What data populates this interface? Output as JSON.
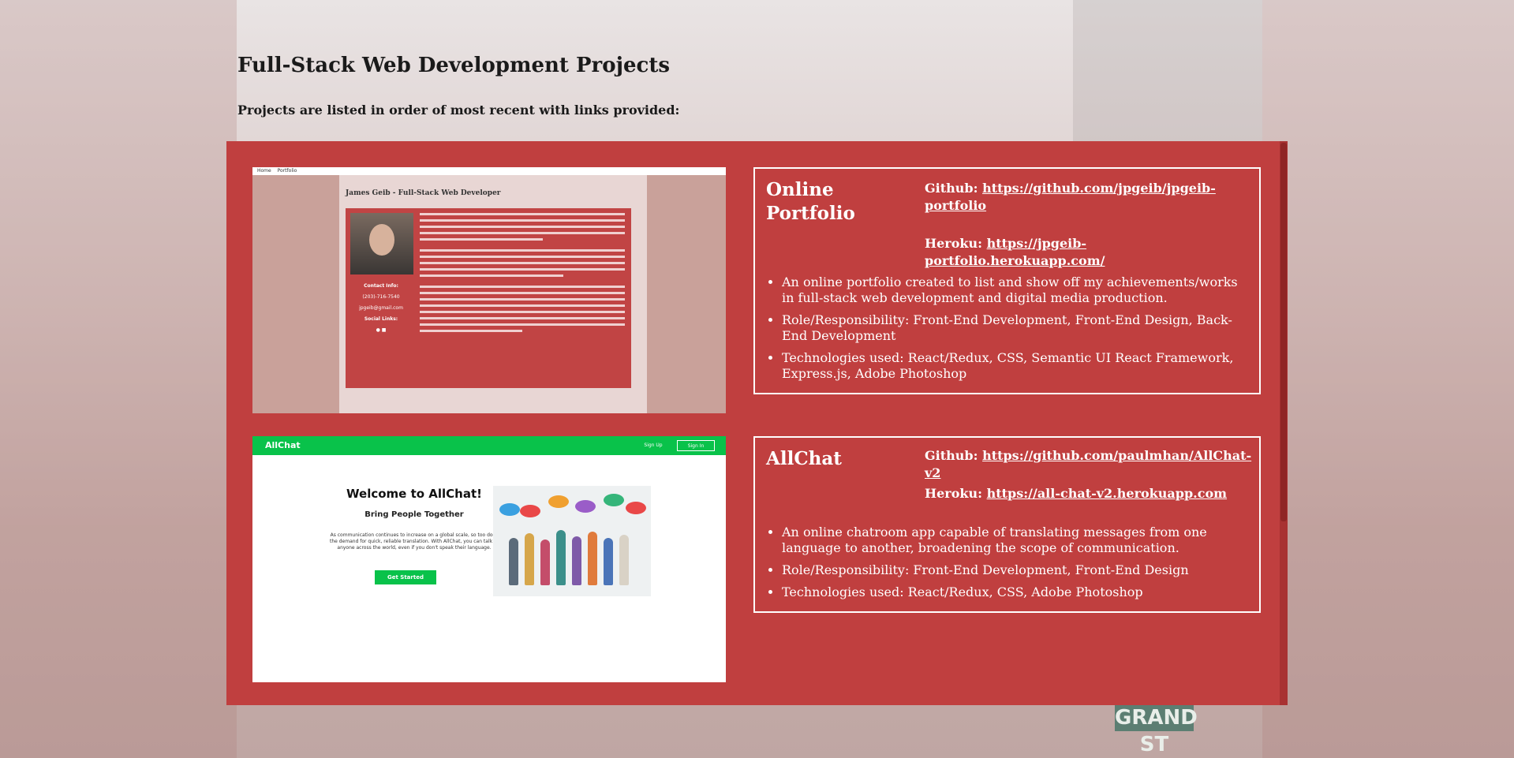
{
  "page": {
    "title": "Full-Stack Web Development Projects",
    "subtitle": "Projects are listed in order of most recent with links provided:"
  },
  "colors": {
    "panel_bg": "#c03f3f",
    "accent_green": "#09c24a",
    "text_white": "#ffffff"
  },
  "projects": [
    {
      "title": "Online Portfolio",
      "github_label": "Github:",
      "github_url": "https://github.com/jpgeib/jpgeib-portfolio",
      "heroku_label": "Heroku:",
      "heroku_url": "https://jpgeib-portfolio.herokuapp.com/",
      "bullets": [
        "An online portfolio created to list and show off my achievements/works in full-stack web development and digital media production.",
        "Role/Responsibility: Front-End Development, Front-End Design, Back-End Development",
        "Technologies used: React/Redux, CSS, Semantic UI React Framework, Express.js, Adobe Photoshop"
      ],
      "preview": {
        "nav": [
          "Home",
          "Portfolio"
        ],
        "heading": "James Geib - Full-Stack Web Developer",
        "contact_label": "Contact Info:",
        "phone": "(203)-716-7540",
        "email": "jpgeib@gmail.com",
        "social_label": "Social Links:"
      }
    },
    {
      "title": "AllChat",
      "github_label": "Github:",
      "github_url": "https://github.com/paulmhan/AllChat-v2",
      "heroku_label": "Heroku:",
      "heroku_url": "https://all-chat-v2.herokuapp.com",
      "bullets": [
        "An online chatroom app capable of translating messages from one language to another, broadening the scope of communication.",
        "Role/Responsibility: Front-End Development, Front-End Design",
        "Technologies used: React/Redux, CSS, Adobe Photoshop"
      ],
      "preview": {
        "logo": "AllChat",
        "signup": "Sign Up",
        "signin": "Sign In",
        "welcome": "Welcome to AllChat!",
        "tagline": "Bring People Together",
        "description": "As communication continues to increase on a global scale, so too does the demand for quick, reliable translation. With AllChat, you can talk to anyone across the world, even if you don't speak their language.",
        "cta": "Get Started"
      }
    }
  ],
  "background": {
    "street_sign": "GRAND ST"
  }
}
